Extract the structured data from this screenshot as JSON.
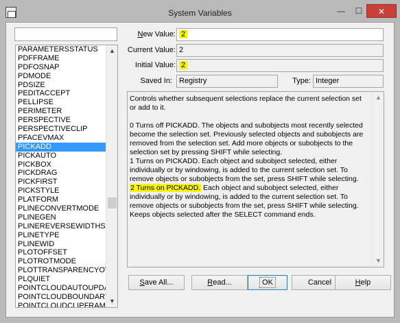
{
  "window": {
    "title": "System Variables",
    "minimize": "—",
    "maximize": "☐",
    "close": "✕"
  },
  "search": {
    "value": ""
  },
  "variables": [
    "PARAMETERSSTATUS",
    "PDFFRAME",
    "PDFOSNAP",
    "PDMODE",
    "PDSIZE",
    "PEDITACCEPT",
    "PELLIPSE",
    "PERIMETER",
    "PERSPECTIVE",
    "PERSPECTIVECLIP",
    "PFACEVMAX",
    "PICKADD",
    "PICKAUTO",
    "PICKBOX",
    "PICKDRAG",
    "PICKFIRST",
    "PICKSTYLE",
    "PLATFORM",
    "PLINECONVERTMODE",
    "PLINEGEN",
    "PLINEREVERSEWIDTHS",
    "PLINETYPE",
    "PLINEWID",
    "PLOTOFFSET",
    "PLOTROTMODE",
    "PLOTTRANSPARENCYOV",
    "PLQUIET",
    "POINTCLOUDAUTOUPDA",
    "POINTCLOUDBOUNDARY",
    "POINTCLOUDCLIPFRAME"
  ],
  "selected_variable": "PICKADD",
  "fields": {
    "new_value_label_pre": "",
    "new_value_label_u": "N",
    "new_value_label_post": "ew Value:",
    "new_value": "2",
    "current_value_label": "Current Value:",
    "current_value": "2",
    "initial_value_label": "Initial Value:",
    "initial_value": "2",
    "saved_in_label": "Saved In:",
    "saved_in": "Registry",
    "type_label": "Type:",
    "type": "Integer"
  },
  "description": {
    "intro": "Controls whether subsequent selections replace the current selection set or add to it.",
    "opt0": "0     Turns off PICKADD. The objects and subobjects most recently selected become the selection set. Previously selected objects and subobjects are removed from the selection set. Add more objects or subobjects to the selection set by pressing SHIFT while selecting.",
    "opt1": "1     Turns on PICKADD. Each object and subobject selected, either individually or by windowing, is added to the current selection set. To remove objects or subobjects from the set, press SHIFT while selecting.",
    "opt2_highlight": "2     Turns on PICKADD.",
    "opt2_rest": " Each object and subobject selected, either individually or by windowing, is added to the current selection set. To remove objects or subobjects from the set, press SHIFT while selecting. Keeps objects selected after the SELECT command ends."
  },
  "buttons": {
    "save_all_u": "S",
    "save_all_rest": "ave All...",
    "read_u": "R",
    "read_rest": "ead...",
    "ok": "OK",
    "cancel": "Cancel",
    "help_u": "H",
    "help_rest": "elp"
  },
  "colors": {
    "highlight": "#f8f30a",
    "selection": "#3399ff",
    "close_button": "#c7403a"
  }
}
